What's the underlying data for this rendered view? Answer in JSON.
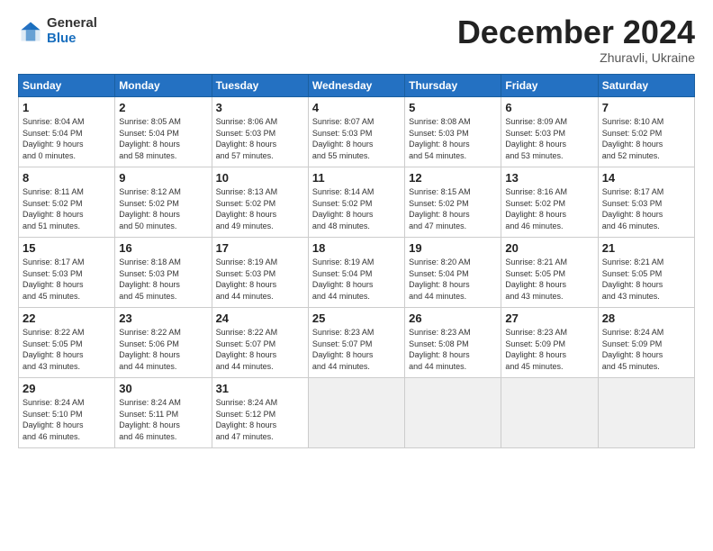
{
  "logo": {
    "general": "General",
    "blue": "Blue"
  },
  "header": {
    "month": "December 2024",
    "location": "Zhuravli, Ukraine"
  },
  "days_of_week": [
    "Sunday",
    "Monday",
    "Tuesday",
    "Wednesday",
    "Thursday",
    "Friday",
    "Saturday"
  ],
  "weeks": [
    [
      {
        "num": "1",
        "info": "Sunrise: 8:04 AM\nSunset: 5:04 PM\nDaylight: 9 hours\nand 0 minutes."
      },
      {
        "num": "2",
        "info": "Sunrise: 8:05 AM\nSunset: 5:04 PM\nDaylight: 8 hours\nand 58 minutes."
      },
      {
        "num": "3",
        "info": "Sunrise: 8:06 AM\nSunset: 5:03 PM\nDaylight: 8 hours\nand 57 minutes."
      },
      {
        "num": "4",
        "info": "Sunrise: 8:07 AM\nSunset: 5:03 PM\nDaylight: 8 hours\nand 55 minutes."
      },
      {
        "num": "5",
        "info": "Sunrise: 8:08 AM\nSunset: 5:03 PM\nDaylight: 8 hours\nand 54 minutes."
      },
      {
        "num": "6",
        "info": "Sunrise: 8:09 AM\nSunset: 5:03 PM\nDaylight: 8 hours\nand 53 minutes."
      },
      {
        "num": "7",
        "info": "Sunrise: 8:10 AM\nSunset: 5:02 PM\nDaylight: 8 hours\nand 52 minutes."
      }
    ],
    [
      {
        "num": "8",
        "info": "Sunrise: 8:11 AM\nSunset: 5:02 PM\nDaylight: 8 hours\nand 51 minutes."
      },
      {
        "num": "9",
        "info": "Sunrise: 8:12 AM\nSunset: 5:02 PM\nDaylight: 8 hours\nand 50 minutes."
      },
      {
        "num": "10",
        "info": "Sunrise: 8:13 AM\nSunset: 5:02 PM\nDaylight: 8 hours\nand 49 minutes."
      },
      {
        "num": "11",
        "info": "Sunrise: 8:14 AM\nSunset: 5:02 PM\nDaylight: 8 hours\nand 48 minutes."
      },
      {
        "num": "12",
        "info": "Sunrise: 8:15 AM\nSunset: 5:02 PM\nDaylight: 8 hours\nand 47 minutes."
      },
      {
        "num": "13",
        "info": "Sunrise: 8:16 AM\nSunset: 5:02 PM\nDaylight: 8 hours\nand 46 minutes."
      },
      {
        "num": "14",
        "info": "Sunrise: 8:17 AM\nSunset: 5:03 PM\nDaylight: 8 hours\nand 46 minutes."
      }
    ],
    [
      {
        "num": "15",
        "info": "Sunrise: 8:17 AM\nSunset: 5:03 PM\nDaylight: 8 hours\nand 45 minutes."
      },
      {
        "num": "16",
        "info": "Sunrise: 8:18 AM\nSunset: 5:03 PM\nDaylight: 8 hours\nand 45 minutes."
      },
      {
        "num": "17",
        "info": "Sunrise: 8:19 AM\nSunset: 5:03 PM\nDaylight: 8 hours\nand 44 minutes."
      },
      {
        "num": "18",
        "info": "Sunrise: 8:19 AM\nSunset: 5:04 PM\nDaylight: 8 hours\nand 44 minutes."
      },
      {
        "num": "19",
        "info": "Sunrise: 8:20 AM\nSunset: 5:04 PM\nDaylight: 8 hours\nand 44 minutes."
      },
      {
        "num": "20",
        "info": "Sunrise: 8:21 AM\nSunset: 5:05 PM\nDaylight: 8 hours\nand 43 minutes."
      },
      {
        "num": "21",
        "info": "Sunrise: 8:21 AM\nSunset: 5:05 PM\nDaylight: 8 hours\nand 43 minutes."
      }
    ],
    [
      {
        "num": "22",
        "info": "Sunrise: 8:22 AM\nSunset: 5:05 PM\nDaylight: 8 hours\nand 43 minutes."
      },
      {
        "num": "23",
        "info": "Sunrise: 8:22 AM\nSunset: 5:06 PM\nDaylight: 8 hours\nand 44 minutes."
      },
      {
        "num": "24",
        "info": "Sunrise: 8:22 AM\nSunset: 5:07 PM\nDaylight: 8 hours\nand 44 minutes."
      },
      {
        "num": "25",
        "info": "Sunrise: 8:23 AM\nSunset: 5:07 PM\nDaylight: 8 hours\nand 44 minutes."
      },
      {
        "num": "26",
        "info": "Sunrise: 8:23 AM\nSunset: 5:08 PM\nDaylight: 8 hours\nand 44 minutes."
      },
      {
        "num": "27",
        "info": "Sunrise: 8:23 AM\nSunset: 5:09 PM\nDaylight: 8 hours\nand 45 minutes."
      },
      {
        "num": "28",
        "info": "Sunrise: 8:24 AM\nSunset: 5:09 PM\nDaylight: 8 hours\nand 45 minutes."
      }
    ],
    [
      {
        "num": "29",
        "info": "Sunrise: 8:24 AM\nSunset: 5:10 PM\nDaylight: 8 hours\nand 46 minutes."
      },
      {
        "num": "30",
        "info": "Sunrise: 8:24 AM\nSunset: 5:11 PM\nDaylight: 8 hours\nand 46 minutes."
      },
      {
        "num": "31",
        "info": "Sunrise: 8:24 AM\nSunset: 5:12 PM\nDaylight: 8 hours\nand 47 minutes."
      },
      null,
      null,
      null,
      null
    ]
  ]
}
